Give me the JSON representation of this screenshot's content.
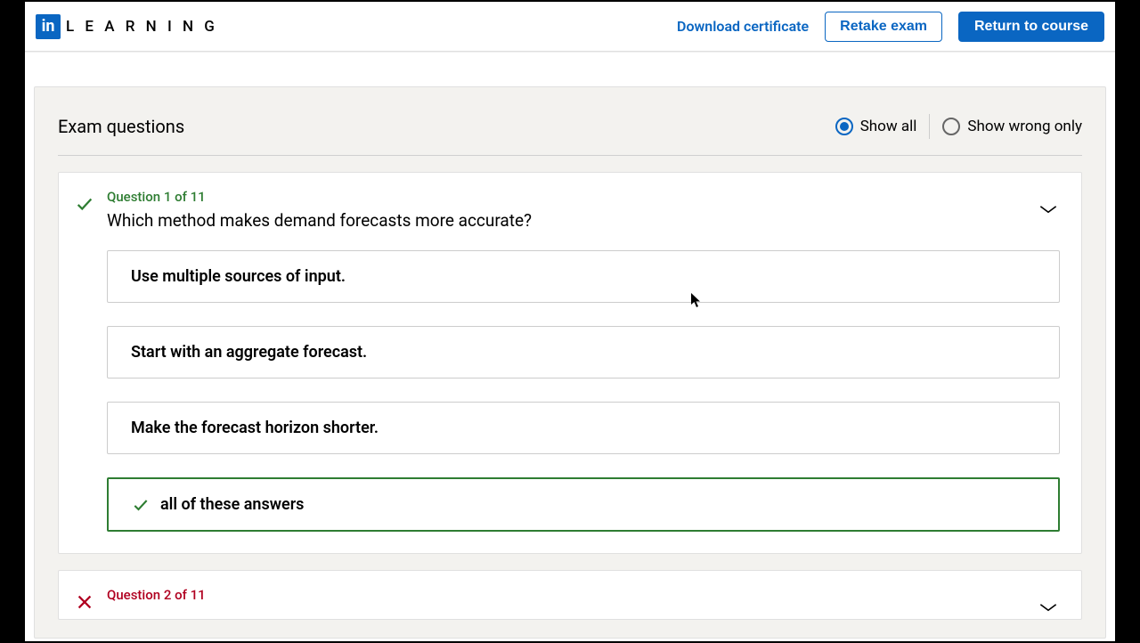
{
  "header": {
    "logo_short": "in",
    "logo_text": "L E A R N I N G",
    "download_label": "Download certificate",
    "retake_label": "Retake exam",
    "return_label": "Return to course"
  },
  "panel": {
    "title": "Exam questions",
    "filter_all": "Show all",
    "filter_wrong": "Show wrong only"
  },
  "questions": [
    {
      "num": "Question 1 of 11",
      "status": "correct",
      "text": "Which method makes demand forecasts more accurate?",
      "answers": [
        {
          "text": "Use multiple sources of input.",
          "correct": false
        },
        {
          "text": "Start with an aggregate forecast.",
          "correct": false
        },
        {
          "text": "Make the forecast horizon shorter.",
          "correct": false
        },
        {
          "text": "all of these answers",
          "correct": true
        }
      ]
    },
    {
      "num": "Question 2 of 11",
      "status": "wrong"
    }
  ]
}
